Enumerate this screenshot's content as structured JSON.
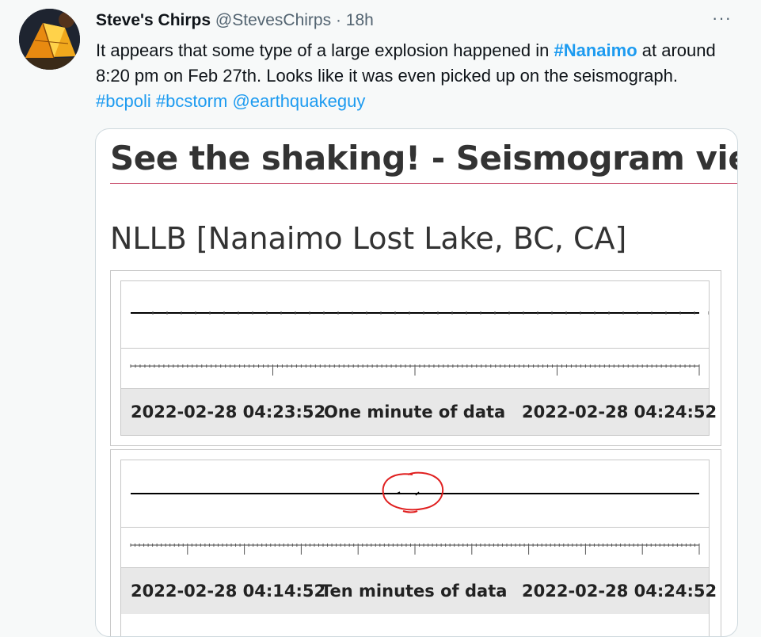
{
  "tweet": {
    "display_name": "Steve's Chirps",
    "handle": "@StevesChirps",
    "separator": "·",
    "time": "18h",
    "more_icon": "···",
    "avatar_icon": "tent-photo-icon",
    "text_part1": "It appears that some type of a large explosion happened in ",
    "hashtag_nanaimo": "#Nanaimo",
    "text_part2": " at around 8:20 pm on Feb 27th.  Looks like it was even picked up on the seismograph. ",
    "hashtag_bcpoli": "#bcpoli",
    "hashtag_bcstorm": "#bcstorm",
    "mention": "@earthquakeguy",
    "link_color": "#1d9bf0"
  },
  "media": {
    "page_heading": "See the shaking! - Seismogram viewer",
    "station_title": "NLLB [Nanaimo Lost Lake, BC, CA]",
    "panels": [
      {
        "start_time": "2022-02-28 04:23:52",
        "label": "One minute of data",
        "end_time": "2022-02-28 04:24:52"
      },
      {
        "start_time": "2022-02-28 04:14:52",
        "label": "Ten minutes of data",
        "end_time": "2022-02-28 04:24:52",
        "annotation_color": "#e02020"
      }
    ]
  }
}
